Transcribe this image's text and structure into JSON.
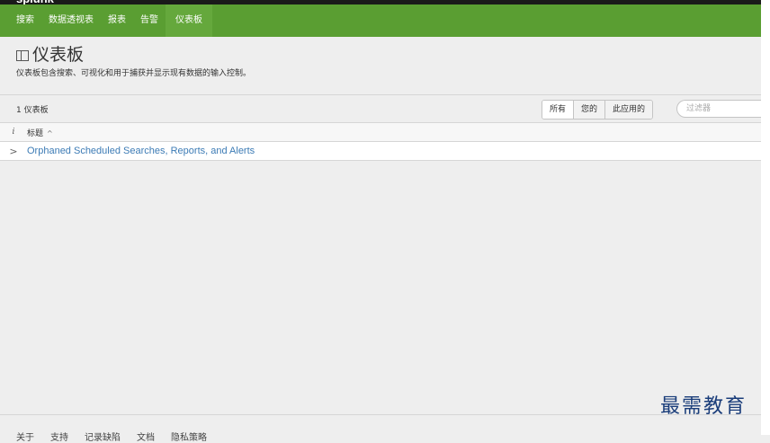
{
  "topbar": {
    "brand": "splunk"
  },
  "nav": {
    "items": [
      {
        "label": "搜索"
      },
      {
        "label": "数据透视表"
      },
      {
        "label": "报表"
      },
      {
        "label": "告警"
      },
      {
        "label": "仪表板"
      }
    ]
  },
  "page": {
    "title": "仪表板",
    "description": "仪表板包含搜索、可视化和用于捕获并显示现有数据的输入控制。"
  },
  "controls": {
    "count_label": "1 仪表板",
    "filters": [
      {
        "label": "所有"
      },
      {
        "label": "您的"
      },
      {
        "label": "此应用的"
      }
    ],
    "filter_placeholder": "过滤器"
  },
  "table": {
    "info_header": "i",
    "title_header": "标题",
    "sort_indicator": "^",
    "rows": [
      {
        "expand": ">",
        "title": "Orphaned Scheduled Searches, Reports, and Alerts"
      }
    ]
  },
  "footer": {
    "links": [
      {
        "label": "关于"
      },
      {
        "label": "支持"
      },
      {
        "label": "记录缺陷"
      },
      {
        "label": "文档"
      },
      {
        "label": "隐私策略"
      }
    ]
  },
  "watermark": {
    "text": "最需教育"
  }
}
